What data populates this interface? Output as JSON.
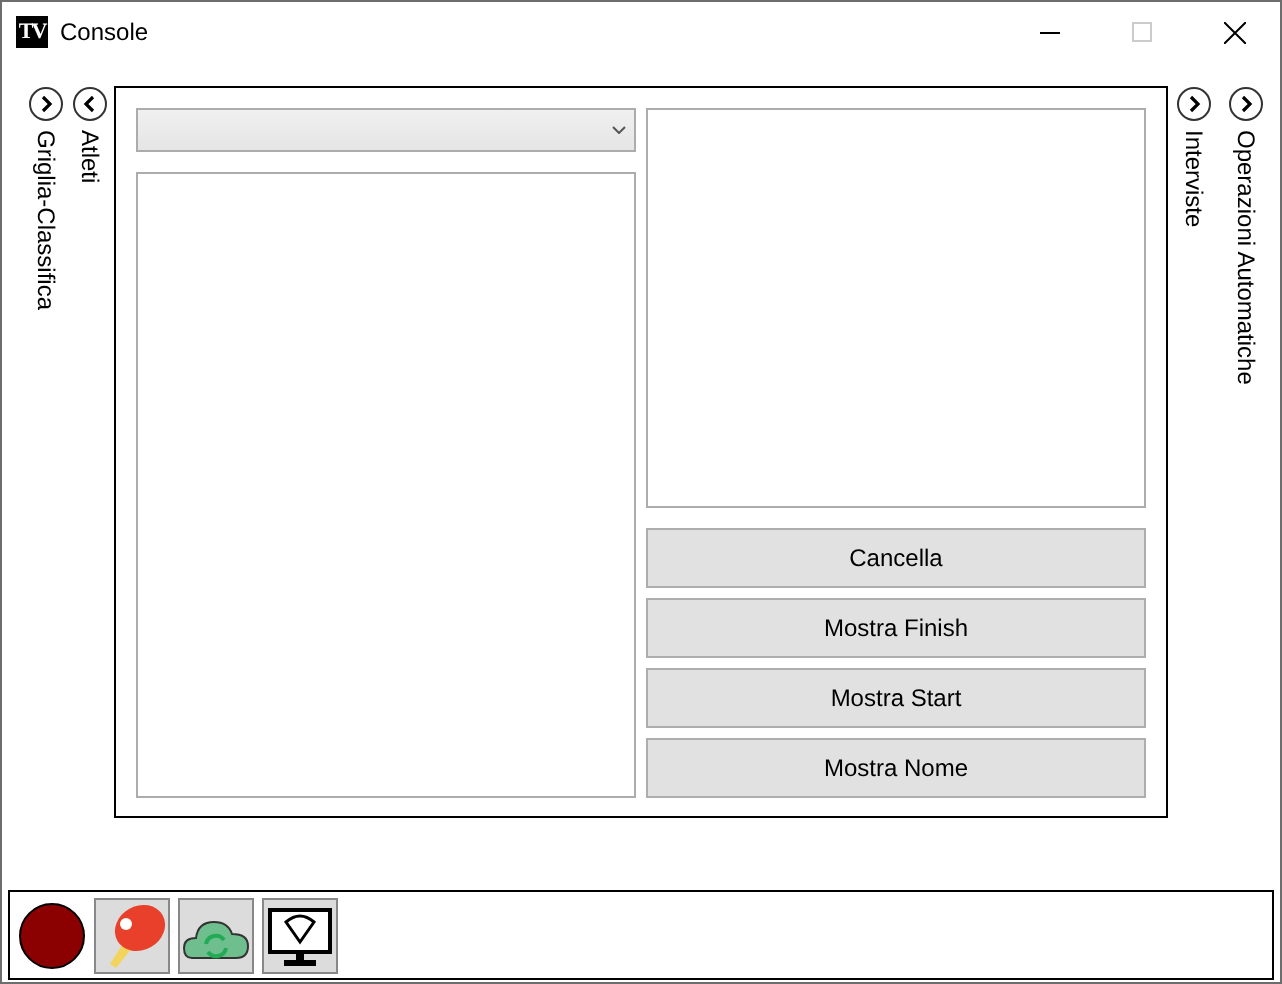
{
  "window": {
    "title": "Console",
    "logo": "TV"
  },
  "left_expanders": [
    {
      "label": "Griglia-Classifica",
      "expanded": false
    },
    {
      "label": "Atleti",
      "expanded": true
    }
  ],
  "right_expanders": [
    {
      "label": "Interviste",
      "expanded": false
    },
    {
      "label": "Operazioni Automatiche",
      "expanded": false
    }
  ],
  "buttons": [
    "Cancella",
    "Mostra Finish",
    "Mostra Start",
    "Mostra Nome"
  ],
  "toolbar": [
    {
      "kind": "record"
    },
    {
      "kind": "paddle"
    },
    {
      "kind": "cloud-sync"
    },
    {
      "kind": "monitor"
    }
  ]
}
